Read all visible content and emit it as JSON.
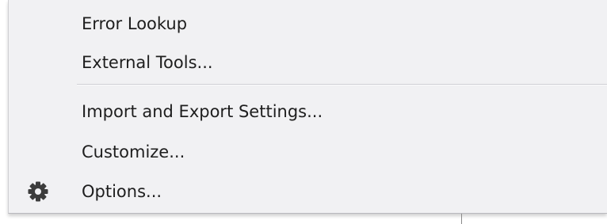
{
  "menu": {
    "items": [
      {
        "label": "Error Lookup"
      },
      {
        "label": "External Tools..."
      },
      {
        "label": "Import and Export Settings..."
      },
      {
        "label": "Customize..."
      },
      {
        "label": "Options...",
        "icon": "gear-icon"
      }
    ]
  },
  "colors": {
    "menu_background": "#f1f1f3",
    "text": "#1e1e1e",
    "icon": "#3c3c3c",
    "separator": "#cfcfd4"
  }
}
